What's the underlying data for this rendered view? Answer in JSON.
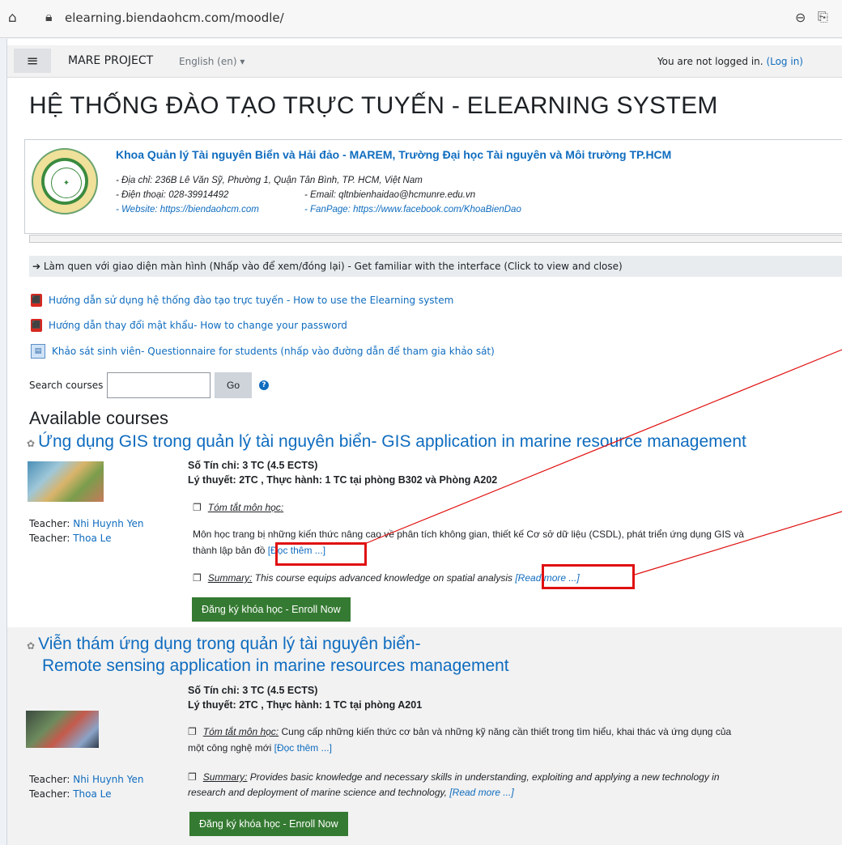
{
  "browser": {
    "url": "elearning.biendaohcm.com/moodle/"
  },
  "navbar": {
    "site_name": "MARE PROJECT",
    "language": "English (en)",
    "login_text": "You are not logged in.",
    "login_link": "(Log in)"
  },
  "page_title": "HỆ THỐNG ĐÀO TẠO TRỰC TUYẾN - ELEARNING SYSTEM",
  "info_box": {
    "faculty": "Khoa Quản lý Tài nguyên Biển và Hải đảo - MAREM, Trường Đại học Tài nguyên và Môi trường TP.HCM",
    "address": "- Địa chỉ: 236B Lê Văn Sỹ, Phường 1, Quận Tân Bình, TP. HCM, Việt Nam",
    "phone": "- Điện thoại: 028-39914492",
    "email": "- Email: qltnbienhaidao@hcmunre.edu.vn",
    "website": "- Website: https://biendaohcm.com",
    "fanpage": "- FanPage: https://www.facebook.com/KhoaBienDao"
  },
  "familiar_bar": "➔ Làm quen với giao diện màn hình (Nhấp vào để xem/đóng lại)  - Get familiar with the interface (Click to view and close)",
  "doc_links": [
    "Hướng dẫn sử dụng hệ thống đào tạo trực tuyến - How to use the Elearning system",
    "Hướng dẫn thay đổi mật khẩu- How to change your password",
    "Khảo sát sinh viên- Questionnaire for students (nhấp vào đường dẫn để tham gia khảo sát)"
  ],
  "search": {
    "label": "Search courses",
    "value": "",
    "button": "Go"
  },
  "available_heading": "Available courses",
  "courses": [
    {
      "title": "Ứng dụng GIS trong quản lý tài nguyên biển- GIS application in marine resource management",
      "credits": "Số Tín chỉ: 3 TC (4.5 ECTS)",
      "hours": "Lý thuyết: 2TC , Thực hành: 1 TC tại phòng B302 và Phòng A202",
      "summary_vi_label": "Tóm tắt môn học:",
      "summary_vi_text_1": "Môn học trang bị những kiến thức nâng cao về phân tích không gian, thiết kế Cơ sở dữ liệu (CSDL), phát triển ứng dụng GIS và",
      "summary_vi_text_2": "thành lập bản đồ",
      "read_more_vi": "[Đọc thêm ...]",
      "summary_en_label": "Summary:",
      "summary_en_text": "This course equips advanced knowledge on spatial analysis",
      "read_more_en": "[Read more ...]",
      "teachers": [
        {
          "role": "Teacher:",
          "name": "Nhi Huynh Yen"
        },
        {
          "role": "Teacher:",
          "name": "Thoa Le"
        }
      ],
      "enroll": "Đăng ký khóa học - Enroll Now"
    },
    {
      "title_line1": "Viễn thám ứng dụng trong quản lý tài nguyên biển-",
      "title_line2": "Remote sensing application in marine resources management",
      "credits": "Số Tín chỉ: 3 TC (4.5 ECTS)",
      "hours": "Lý thuyết: 2TC , Thực hành: 1 TC tại phòng A201",
      "summary_vi_label": "Tóm tắt môn học:",
      "summary_vi_text_1": "Cung cấp những kiến thức cơ bản và những kỹ năng cần thiết trong tìm hiểu, khai thác và ứng dụng của",
      "summary_vi_text_2": "một công nghệ mới",
      "read_more_vi": "[Đọc thêm ...]",
      "summary_en_label": "Summary:",
      "summary_en_text_1": "Provides basic knowledge and necessary skills in understanding, exploiting and applying a new technology in",
      "summary_en_text_2": "research and deployment of marine science and technology,",
      "read_more_en": "[Read more ...]",
      "teachers": [
        {
          "role": "Teacher:",
          "name": "Nhi Huynh Yen"
        },
        {
          "role": "Teacher:",
          "name": "Thoa Le"
        }
      ],
      "enroll": "Đăng ký khóa học - Enroll Now"
    }
  ],
  "colors": {
    "link": "#0f6cbf",
    "enroll_button": "#357a32",
    "annotation": "#e01010"
  }
}
